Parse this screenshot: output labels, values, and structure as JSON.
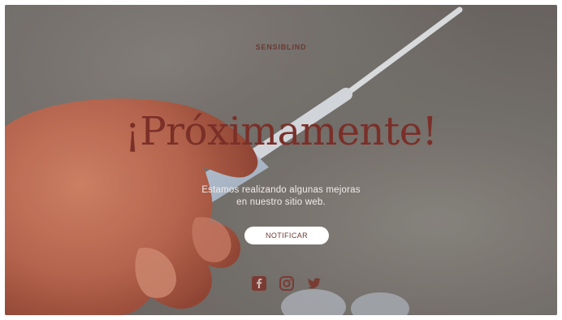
{
  "brand": "SENSIBLIND",
  "headline": "¡Próximamente!",
  "subtitle_line1": "Estamos realizando algunas mejoras",
  "subtitle_line2": "en nuestro sitio web.",
  "cta_label": "NOTIFICAR",
  "social_icons": [
    "facebook-icon",
    "instagram-icon",
    "twitter-icon"
  ],
  "colors": {
    "accent": "#7a2f28",
    "icon": "#7a3b33",
    "button_bg": "#ffffff"
  }
}
